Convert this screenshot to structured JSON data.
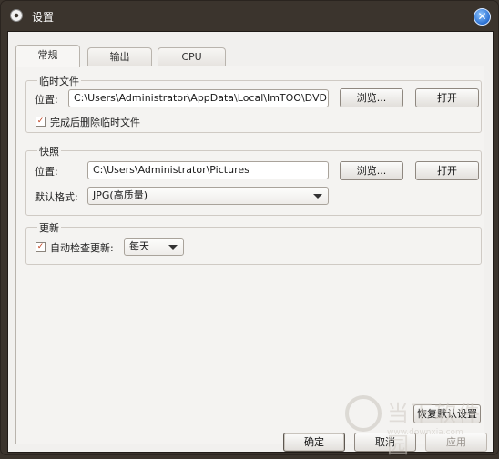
{
  "window": {
    "title": "设置"
  },
  "tabs": [
    {
      "label": "常规"
    },
    {
      "label": "输出"
    },
    {
      "label": "CPU"
    }
  ],
  "temp_files": {
    "title": "临时文件",
    "location_label": "位置:",
    "location_value": "C:\\Users\\Administrator\\AppData\\Local\\ImTOO\\DVD",
    "browse_label": "浏览...",
    "open_label": "打开",
    "delete_after_label": "完成后删除临时文件",
    "delete_after_checked": true
  },
  "snapshot": {
    "title": "快照",
    "location_label": "位置:",
    "location_value": "C:\\Users\\Administrator\\Pictures",
    "browse_label": "浏览...",
    "open_label": "打开",
    "format_label": "默认格式:",
    "format_value": "JPG(高质量)"
  },
  "update": {
    "title": "更新",
    "auto_check_label": "自动检查更新:",
    "auto_check_checked": true,
    "frequency_value": "每天"
  },
  "restore_defaults_label": "恢复默认设置",
  "footer": {
    "ok_label": "确定",
    "cancel_label": "取消",
    "apply_label": "应用"
  },
  "watermark": {
    "text": "当下软件园",
    "url": "www.downxia.com"
  },
  "colors": {
    "titlebar": "#3b342d",
    "client": "#f1f0ee",
    "check_mark": "#c0401d"
  },
  "icons": {
    "app": "disc-icon",
    "close": "close-icon",
    "dropdown": "chevron-down-icon"
  }
}
